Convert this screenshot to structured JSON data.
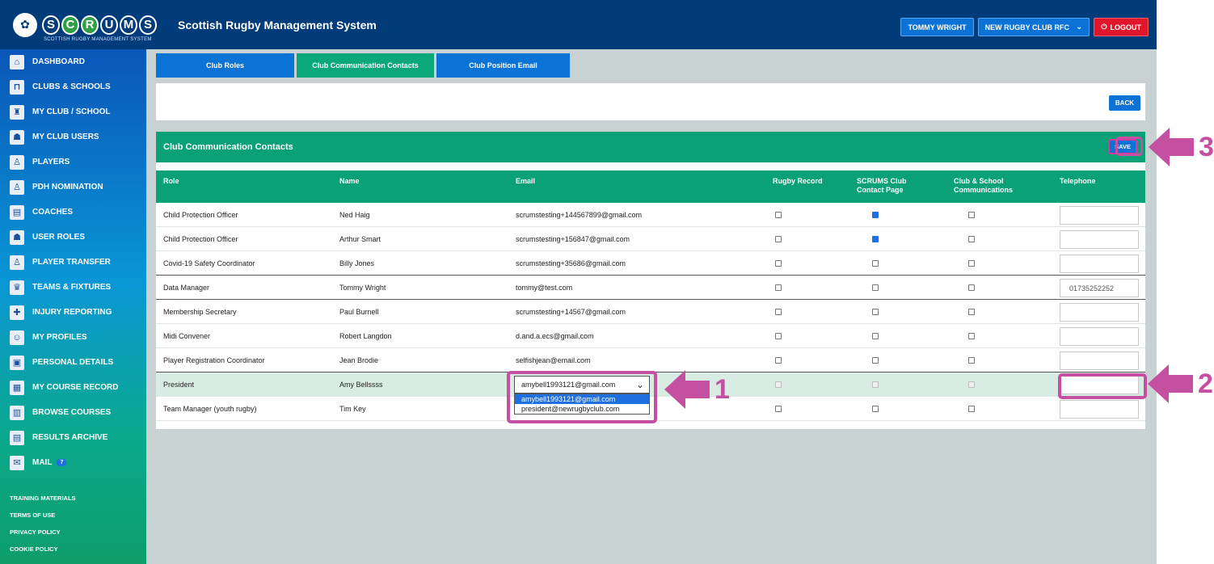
{
  "header": {
    "logo_mark": "SCOTTISH RUGBY",
    "logo_letters": [
      "S",
      "C",
      "R",
      "U",
      "M",
      "S"
    ],
    "logo_subtitle": "SCOTTISH RUGBY MANAGEMENT SYSTEM",
    "title": "Scottish Rugby Management System",
    "user_label": "TOMMY WRIGHT",
    "club_label": "NEW RUGBY CLUB RFC",
    "logout_label": "LOGOUT"
  },
  "sidebar": {
    "items": [
      {
        "label": "DASHBOARD",
        "icon": "home-icon"
      },
      {
        "label": "CLUBS & SCHOOLS",
        "icon": "goalposts-icon"
      },
      {
        "label": "MY CLUB / SCHOOL",
        "icon": "club-icon"
      },
      {
        "label": "MY CLUB USERS",
        "icon": "users-icon"
      },
      {
        "label": "PLAYERS",
        "icon": "player-icon"
      },
      {
        "label": "PDH NOMINATION",
        "icon": "nomination-icon"
      },
      {
        "label": "COACHES",
        "icon": "clipboard-icon"
      },
      {
        "label": "USER ROLES",
        "icon": "roles-icon"
      },
      {
        "label": "PLAYER TRANSFER",
        "icon": "transfer-icon"
      },
      {
        "label": "TEAMS & FIXTURES",
        "icon": "trophy-icon"
      },
      {
        "label": "INJURY REPORTING",
        "icon": "injury-icon"
      },
      {
        "label": "MY PROFILES",
        "icon": "profile-icon"
      },
      {
        "label": "PERSONAL DETAILS",
        "icon": "id-card-icon"
      },
      {
        "label": "MY COURSE RECORD",
        "icon": "course-icon"
      },
      {
        "label": "BROWSE COURSES",
        "icon": "browse-icon"
      },
      {
        "label": "RESULTS ARCHIVE",
        "icon": "archive-icon"
      },
      {
        "label": "MAIL",
        "icon": "mail-icon",
        "badge": "7"
      }
    ],
    "footer_links": [
      "TRAINING MATERIALS",
      "TERMS OF USE",
      "PRIVACY POLICY",
      "COOKIE POLICY"
    ]
  },
  "tabs": [
    {
      "label": "Club Roles",
      "active": false
    },
    {
      "label": "Club Communication Contacts",
      "active": true
    },
    {
      "label": "Club Position Email",
      "active": false
    }
  ],
  "back_label": "BACK",
  "card": {
    "title": "Club Communication Contacts",
    "save_label": "SAVE",
    "columns": [
      "Role",
      "Name",
      "Email",
      "Rugby Record",
      "SCRUMS Club Contact Page",
      "Club & School Communications",
      "Telephone"
    ],
    "rows": [
      {
        "role": "Child Protection Officer",
        "name": "Ned Haig",
        "email": "scrumstesting+144567899@gmail.com",
        "rugby": false,
        "contact": true,
        "comms": false,
        "tel": ""
      },
      {
        "role": "Child Protection Officer",
        "name": "Arthur Smart",
        "email": "scrumstesting+156847@gmail.com",
        "rugby": false,
        "contact": true,
        "comms": false,
        "tel": ""
      },
      {
        "role": "Covid-19 Safety Coordinator",
        "name": "Billy Jones",
        "email": "scrumstesting+35686@gmail.com",
        "rugby": false,
        "contact": false,
        "comms": false,
        "tel": ""
      },
      {
        "role": "Data Manager",
        "name": "Tommy Wright",
        "email": "tommy@test.com",
        "rugby": false,
        "contact": false,
        "comms": false,
        "tel": "01735252252"
      },
      {
        "role": "Membership Secretary",
        "name": "Paul Burnell",
        "email": "scrumstesting+14567@gmail.com",
        "rugby": false,
        "contact": false,
        "comms": false,
        "tel": ""
      },
      {
        "role": "Midi Convener",
        "name": "Robert Langdon",
        "email": "d.and.a.ecs@gmail.com",
        "rugby": false,
        "contact": false,
        "comms": false,
        "tel": ""
      },
      {
        "role": "Player Registration Coordinator",
        "name": "Jean Brodie",
        "email": "selfishjean@email.com",
        "rugby": false,
        "contact": false,
        "comms": false,
        "tel": ""
      },
      {
        "role": "President",
        "name": "Amy Bellssss",
        "email_select": "amybell1993121@gmail.com",
        "email_options": [
          "amybell1993121@gmail.com",
          "president@newrugbyclub.com"
        ],
        "rugby": false,
        "contact": false,
        "comms": false,
        "tel": "",
        "disabled": true
      },
      {
        "role": "Team Manager (youth rugby)",
        "name": "Tim Key",
        "email": "",
        "rugby": false,
        "contact": false,
        "comms": false,
        "tel": ""
      }
    ]
  },
  "annotations": {
    "step1": "1",
    "step2": "2",
    "step3": "3",
    "color": "#c54fa0"
  }
}
